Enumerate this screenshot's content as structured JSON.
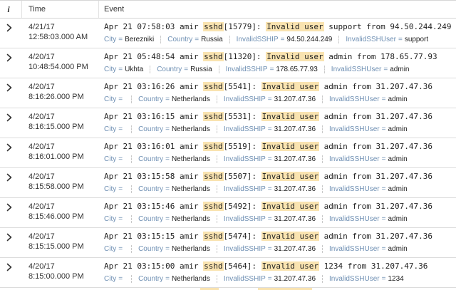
{
  "table": {
    "headers": {
      "info": "i",
      "time": "Time",
      "event": "Event"
    }
  },
  "field_labels": {
    "city": "City",
    "country": "Country",
    "ip": "InvalidSSHIP",
    "user": "InvalidSSHUser"
  },
  "events": [
    {
      "date": "4/21/17",
      "time": "12:58:03.000 AM",
      "prefix": "Apr 21 07:58:03 amir ",
      "proc": "sshd",
      "pid": "[15779]: ",
      "msg": "Invalid user",
      "rest": " support from 94.50.244.249",
      "city": "Berezniki",
      "country": "Russia",
      "ip": "94.50.244.249",
      "user": "support"
    },
    {
      "date": "4/20/17",
      "time": "10:48:54.000 PM",
      "prefix": "Apr 21 05:48:54 amir ",
      "proc": "sshd",
      "pid": "[11320]: ",
      "msg": "Invalid user",
      "rest": " admin from 178.65.77.93",
      "city": "Ukhta",
      "country": "Russia",
      "ip": "178.65.77.93",
      "user": "admin"
    },
    {
      "date": "4/20/17",
      "time": "8:16:26.000 PM",
      "prefix": "Apr 21 03:16:26 amir ",
      "proc": "sshd",
      "pid": "[5541]: ",
      "msg": "Invalid user",
      "rest": " admin from 31.207.47.36",
      "city": "",
      "country": "Netherlands",
      "ip": "31.207.47.36",
      "user": "admin"
    },
    {
      "date": "4/20/17",
      "time": "8:16:15.000 PM",
      "prefix": "Apr 21 03:16:15 amir ",
      "proc": "sshd",
      "pid": "[5531]: ",
      "msg": "Invalid user",
      "rest": " admin from 31.207.47.36",
      "city": "",
      "country": "Netherlands",
      "ip": "31.207.47.36",
      "user": "admin"
    },
    {
      "date": "4/20/17",
      "time": "8:16:01.000 PM",
      "prefix": "Apr 21 03:16:01 amir ",
      "proc": "sshd",
      "pid": "[5519]: ",
      "msg": "Invalid user",
      "rest": " admin from 31.207.47.36",
      "city": "",
      "country": "Netherlands",
      "ip": "31.207.47.36",
      "user": "admin"
    },
    {
      "date": "4/20/17",
      "time": "8:15:58.000 PM",
      "prefix": "Apr 21 03:15:58 amir ",
      "proc": "sshd",
      "pid": "[5507]: ",
      "msg": "Invalid user",
      "rest": " admin from 31.207.47.36",
      "city": "",
      "country": "Netherlands",
      "ip": "31.207.47.36",
      "user": "admin"
    },
    {
      "date": "4/20/17",
      "time": "8:15:46.000 PM",
      "prefix": "Apr 21 03:15:46 amir ",
      "proc": "sshd",
      "pid": "[5492]: ",
      "msg": "Invalid user",
      "rest": " admin from 31.207.47.36",
      "city": "",
      "country": "Netherlands",
      "ip": "31.207.47.36",
      "user": "admin"
    },
    {
      "date": "4/20/17",
      "time": "8:15:15.000 PM",
      "prefix": "Apr 21 03:15:15 amir ",
      "proc": "sshd",
      "pid": "[5474]: ",
      "msg": "Invalid user",
      "rest": " admin from 31.207.47.36",
      "city": "",
      "country": "Netherlands",
      "ip": "31.207.47.36",
      "user": "admin"
    },
    {
      "date": "4/20/17",
      "time": "8:15:00.000 PM",
      "prefix": "Apr 21 03:15:00 amir ",
      "proc": "sshd",
      "pid": "[5464]: ",
      "msg": "Invalid user",
      "rest": " 1234 from 31.207.47.36",
      "city": "",
      "country": "Netherlands",
      "ip": "31.207.47.36",
      "user": "1234"
    }
  ],
  "colors": {
    "highlight": "#f9e3b0",
    "field_key": "#6e8fb3",
    "row_border": "#dcdcdc"
  },
  "icons": {
    "expand": "chevron-right-icon"
  }
}
